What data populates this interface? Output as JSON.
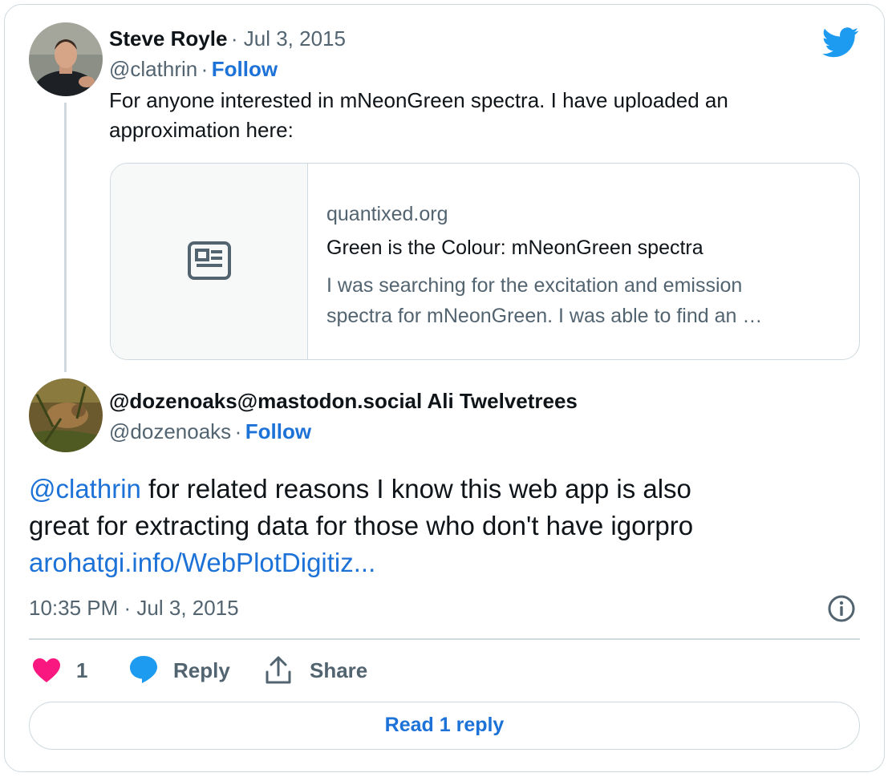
{
  "tweet1": {
    "name": "Steve Royle",
    "date": "· Jul 3, 2015",
    "handle": "@clathrin",
    "sep": "·",
    "follow": "Follow",
    "text_line1": "For anyone interested in mNeonGreen spectra. I have uploaded an",
    "text_line2": "approximation here:",
    "preview": {
      "domain": "quantixed.org",
      "title": "Green is the Colour: mNeonGreen spectra",
      "desc_line1": "I was searching for the excitation and emission",
      "desc_line2": "spectra for mNeonGreen. I was able to find an …",
      "icon": "article-icon"
    }
  },
  "tweet2": {
    "name": "@dozenoaks@mastodon.social Ali Twelvetrees",
    "handle": "@dozenoaks",
    "sep": "·",
    "follow": "Follow",
    "mention": "@clathrin",
    "text_after_mention": " for related reasons I know this web app is also",
    "text_line2": "great for extracting data for those who don't have igorpro",
    "link": "arohatgi.info/WebPlotDigitiz..."
  },
  "meta": {
    "timestamp": "10:35 PM · Jul 3, 2015",
    "info_icon": "info-icon"
  },
  "actions": {
    "like_count": "1",
    "reply_label": "Reply",
    "share_label": "Share"
  },
  "read_reply": "Read 1 reply",
  "colors": {
    "link": "#1d72d8",
    "like": "#f91880",
    "twitter": "#1d9bf0",
    "muted": "#536471",
    "border": "#cfd9de"
  }
}
